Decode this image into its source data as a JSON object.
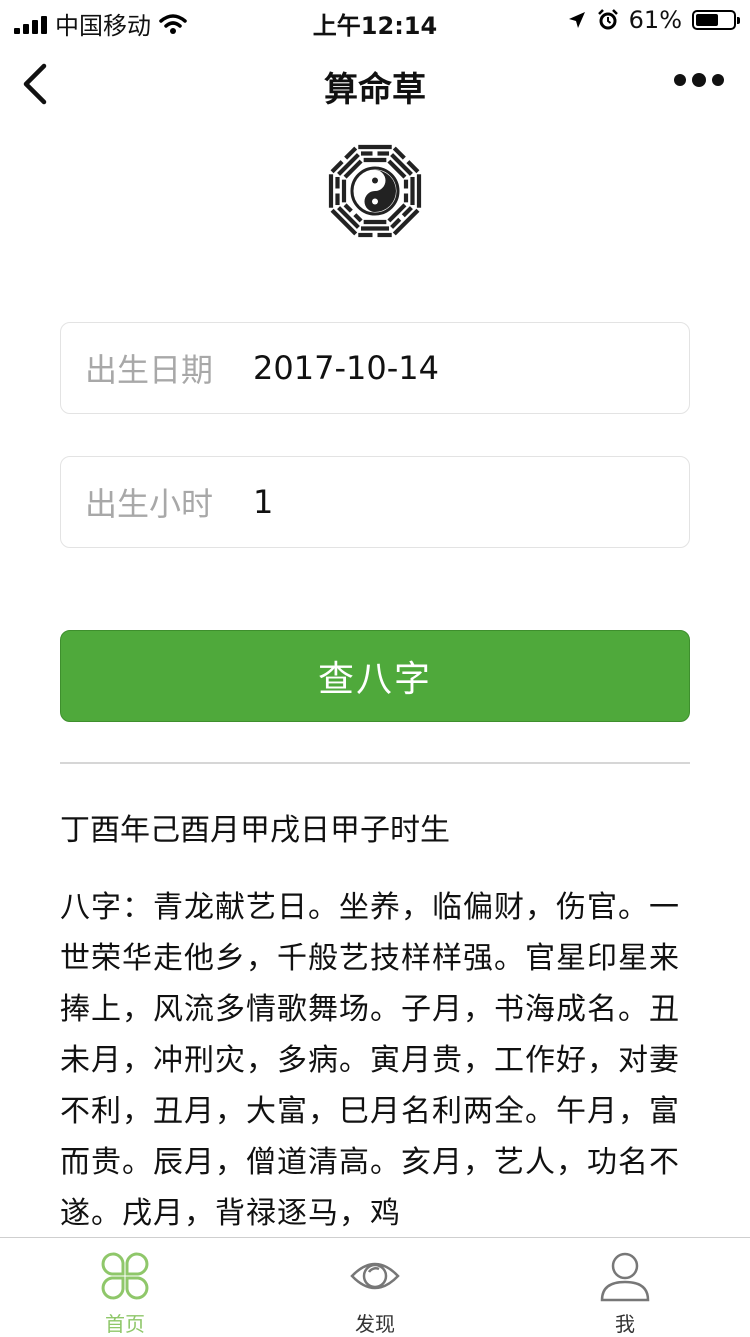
{
  "status_bar": {
    "carrier": "中国移动",
    "time": "上午12:14",
    "battery_text": "61%",
    "battery_level": 0.61
  },
  "navbar": {
    "title": "算命草",
    "back_icon": "chevron-left-icon",
    "more_icon": "more-dots-icon"
  },
  "logo_icon": "bagua-yin-yang-icon",
  "form": {
    "birth_date": {
      "label": "出生日期",
      "value": "2017-10-14"
    },
    "birth_hour": {
      "label": "出生小时",
      "value": "1"
    },
    "submit_label": "查八字"
  },
  "result": {
    "title": "丁酉年己酉月甲戌日甲子时生",
    "body": "八字：青龙献艺日。坐养，临偏财，伤官。一世荣华走他乡，千般艺技样样强。官星印星来捧上，风流多情歌舞场。子月，书海成名。丑未月，冲刑灾，多病。寅月贵，工作好，对妻不利，丑月，大富，巳月名利两全。午月，富而贵。辰月，僧道清高。亥月，艺人，功名不遂。戌月，背禄逐马，鸡"
  },
  "tabbar": {
    "items": [
      {
        "label": "首页",
        "icon": "clover-icon",
        "active": true
      },
      {
        "label": "发现",
        "icon": "eye-icon",
        "active": false
      },
      {
        "label": "我",
        "icon": "user-icon",
        "active": false
      }
    ]
  },
  "colors": {
    "primary_button": "#4fa93b",
    "active_tab": "#8fc76a",
    "placeholder_label": "#a8a8a8"
  }
}
